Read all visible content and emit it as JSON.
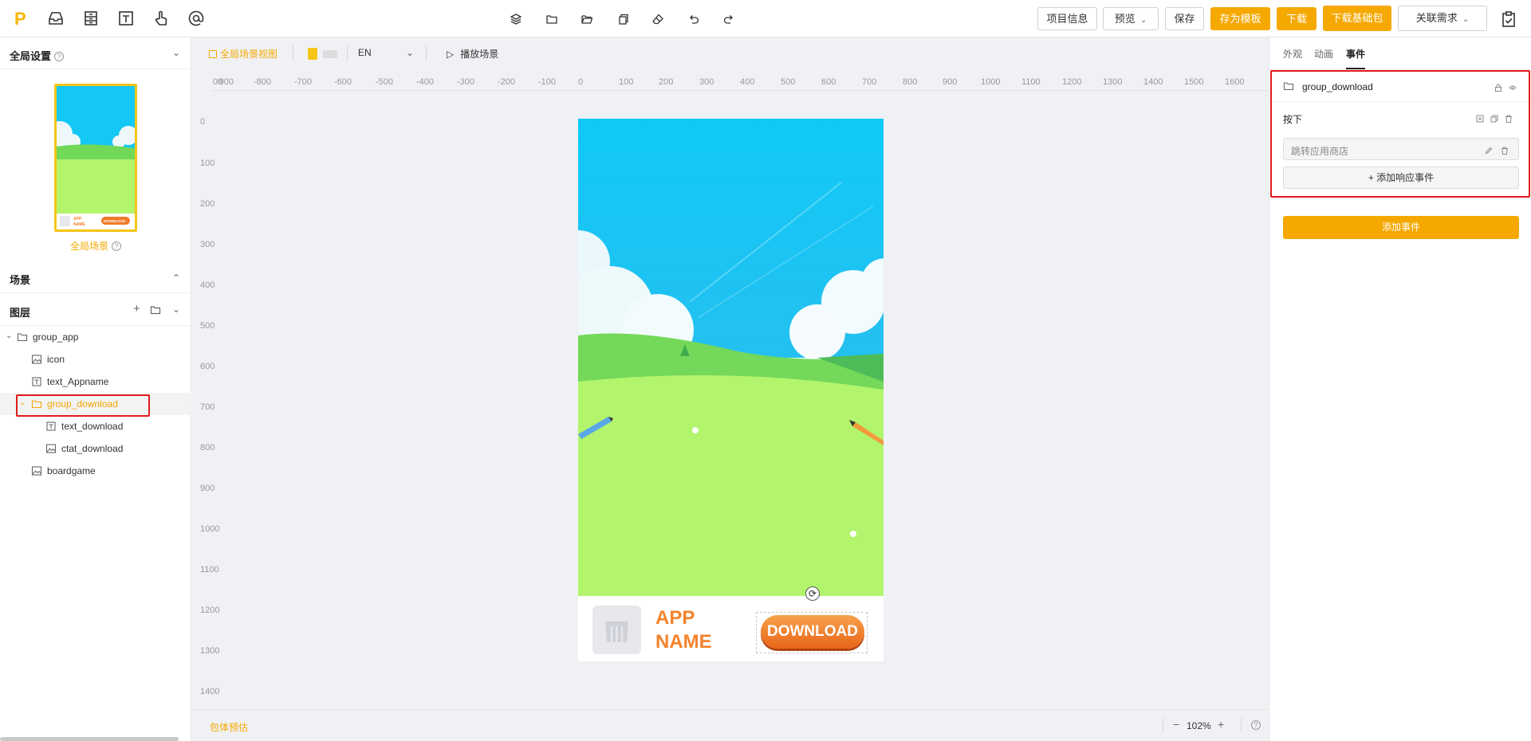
{
  "topbar": {
    "logo_letter": "P",
    "buttons": {
      "project_info": "项目信息",
      "preview": "预览",
      "save": "保存",
      "save_template": "存为模板",
      "download": "下载",
      "download_base": "下载基础包",
      "related": "关联需求"
    }
  },
  "left": {
    "global_settings": "全局设置",
    "global_scene": "全局场景",
    "scene": "场景",
    "layers": "图层",
    "tree": [
      {
        "label": "group_app"
      },
      {
        "label": "icon"
      },
      {
        "label": "text_Appname"
      },
      {
        "label": "group_download"
      },
      {
        "label": "text_download"
      },
      {
        "label": "ctat_download"
      },
      {
        "label": "boardgame"
      }
    ],
    "thumb_app": "APP NAME",
    "thumb_btn": "DOWNLOAD"
  },
  "canvas": {
    "global_view": "全局场景视图",
    "language": "EN",
    "play": "播放场景",
    "ruler_h": [
      "-1000",
      "-900",
      "-800",
      "-700",
      "-600",
      "-500",
      "-400",
      "-300",
      "-200",
      "-100",
      "0",
      "100",
      "200",
      "300",
      "400",
      "500",
      "600",
      "700",
      "800",
      "900",
      "1000",
      "1100",
      "1200",
      "1300",
      "1400",
      "1500",
      "1600"
    ],
    "ruler_v": [
      "0",
      "100",
      "200",
      "300",
      "400",
      "500",
      "600",
      "700",
      "800",
      "900",
      "1000",
      "1100",
      "1200",
      "1300",
      "1400"
    ],
    "app_name_line1": "APP",
    "app_name_line2": "NAME",
    "download_label": "DOWNLOAD",
    "package_estimate": "包体预估",
    "zoom": "102%"
  },
  "right": {
    "tabs": [
      "外观",
      "动画",
      "事件"
    ],
    "group_name": "group_download",
    "press": "按下",
    "action_placeholder": "跳转应用商店",
    "add_response": "+ 添加响应事件",
    "add_event": "添加事件"
  },
  "colors": {
    "accent": "#f5a800",
    "highlight": "#e31a1a"
  }
}
